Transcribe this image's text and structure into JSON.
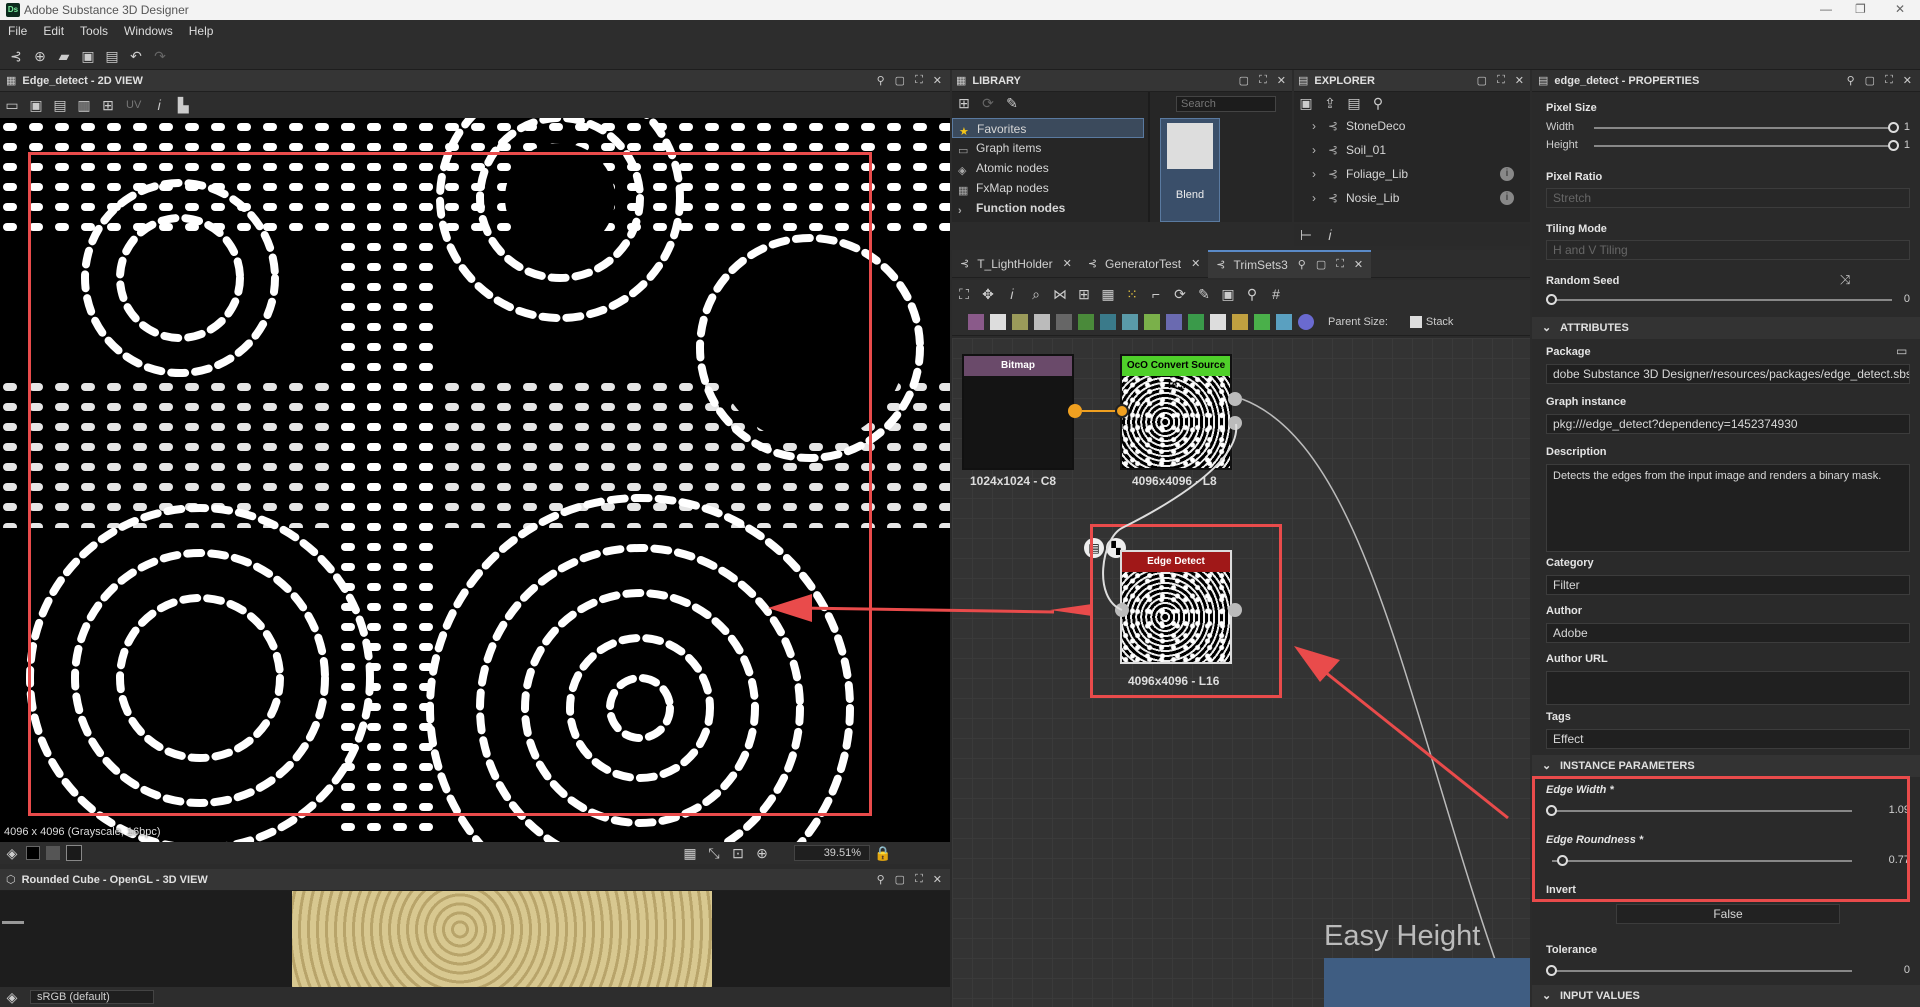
{
  "app": {
    "title": "Adobe Substance 3D Designer",
    "logo": "Ds",
    "menu": [
      "File",
      "Edit",
      "Tools",
      "Windows",
      "Help"
    ]
  },
  "view2d": {
    "title": "Edge_detect - 2D VIEW",
    "uv_label": "UV",
    "status": "4096 x 4096 (Grayscale, 16bpc)",
    "zoom": "39.51%"
  },
  "view3d": {
    "title": "Rounded Cube - OpenGL - 3D VIEW",
    "colorspace": "sRGB (default)"
  },
  "library": {
    "title": "LIBRARY",
    "items": [
      "Favorites",
      "Graph items",
      "Atomic nodes",
      "FxMap nodes",
      "Function nodes"
    ],
    "search_placeholder": "Search",
    "preview_label": "Blend"
  },
  "explorer": {
    "title": "EXPLORER",
    "items": [
      "StoneDeco",
      "Soil_01",
      "Foliage_Lib",
      "Nosie_Lib"
    ]
  },
  "graph": {
    "tabs": [
      "T_LightHolder",
      "GeneratorTest",
      "TrimSets3"
    ],
    "parent_size_label": "Parent Size:",
    "stack_label": "Stack",
    "nodes": {
      "bitmap": {
        "title": "Bitmap",
        "size": "1024x1024 - C8"
      },
      "convert": {
        "title": "OcO Convert Source Te...",
        "size": "4096x4096 - L8"
      },
      "edge": {
        "title": "Edge Detect",
        "size": "4096x4096 - L16"
      }
    },
    "frame_label": "Easy Height"
  },
  "properties": {
    "title": "edge_detect - PROPERTIES",
    "pixel_size": {
      "label": "Pixel Size",
      "width_label": "Width",
      "width_value": "1",
      "height_label": "Height",
      "height_value": "1"
    },
    "pixel_ratio": {
      "label": "Pixel Ratio",
      "value": "Stretch"
    },
    "tiling_mode": {
      "label": "Tiling Mode",
      "value": "H and V Tiling"
    },
    "random_seed": {
      "label": "Random Seed",
      "value": "0"
    },
    "attributes": {
      "header": "ATTRIBUTES",
      "package_label": "Package",
      "package_value": "dobe Substance 3D Designer/resources/packages/edge_detect.sbs",
      "graph_instance_label": "Graph instance",
      "graph_instance_value": "pkg:///edge_detect?dependency=1452374930",
      "description_label": "Description",
      "description_value": "Detects the edges from the input image and renders a binary mask.",
      "category_label": "Category",
      "category_value": "Filter",
      "author_label": "Author",
      "author_value": "Adobe",
      "author_url_label": "Author URL",
      "author_url_value": "",
      "tags_label": "Tags",
      "tags_value": "Effect"
    },
    "instance": {
      "header": "INSTANCE PARAMETERS",
      "edge_width_label": "Edge Width *",
      "edge_width_value": "1.09",
      "edge_roundness_label": "Edge Roundness *",
      "edge_roundness_value": "0.77",
      "invert_label": "Invert",
      "invert_value": "False",
      "tolerance_label": "Tolerance",
      "tolerance_value": "0"
    },
    "input_values_header": "INPUT VALUES"
  },
  "colors": {
    "highlight_red": "#e94b4b",
    "bitmap_header": "#6a4a6a",
    "convert_header": "#4fd02a",
    "edge_header": "#a01818",
    "frame": "#3f5d82"
  }
}
